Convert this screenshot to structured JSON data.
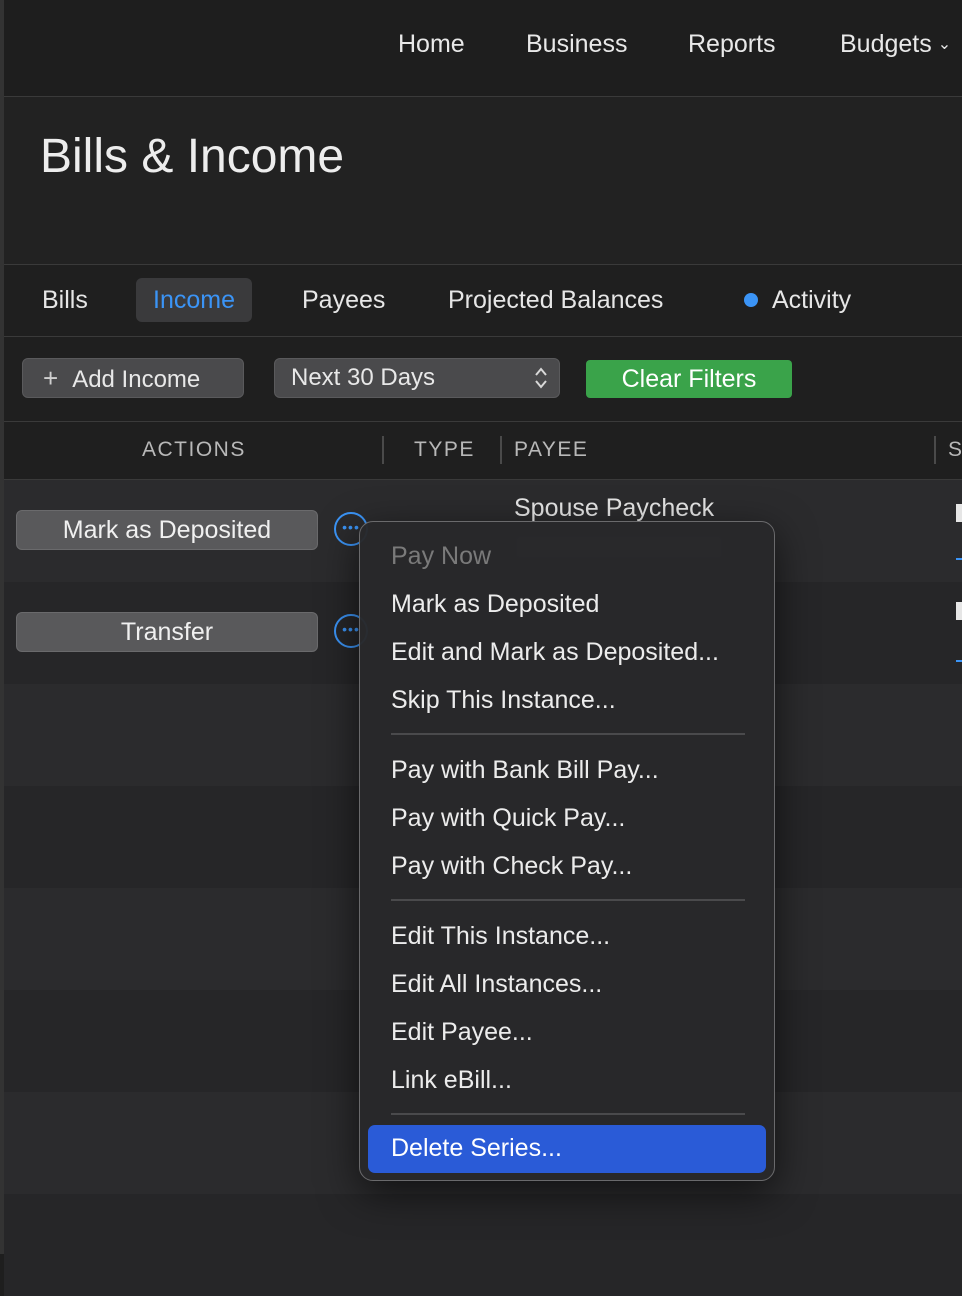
{
  "nav": {
    "items": [
      "Home",
      "Business",
      "Reports",
      "Budgets"
    ]
  },
  "header": {
    "title": "Bills & Income"
  },
  "tabs": [
    {
      "label": "Bills"
    },
    {
      "label": "Income",
      "active": true
    },
    {
      "label": "Payees"
    },
    {
      "label": "Projected Balances"
    },
    {
      "label": "Activity",
      "indicator": "blue-dot"
    }
  ],
  "toolbar": {
    "add_label": "Add Income",
    "range_value": "Next 30 Days",
    "clear_label": "Clear Filters"
  },
  "table": {
    "columns": [
      "ACTIONS",
      "TYPE",
      "PAYEE",
      "S"
    ],
    "rows": [
      {
        "action": "Mark as Deposited",
        "payee": "Spouse Paycheck"
      },
      {
        "action": "Transfer",
        "payee": ""
      }
    ]
  },
  "menu": {
    "items": [
      "Pay Now",
      "Mark as Deposited",
      "Edit and Mark as Deposited...",
      "Skip This Instance...",
      "Pay with Bank Bill Pay...",
      "Pay with Quick Pay...",
      "Pay with Check Pay...",
      "Edit This Instance...",
      "Edit All Instances...",
      "Edit Payee...",
      "Link eBill...",
      "Delete Series..."
    ],
    "disabled": [
      "Pay Now"
    ],
    "highlighted": "Delete Series..."
  },
  "colors": {
    "accent": "#3b94f6",
    "clear_button": "#3aa34a",
    "menu_highlight": "#2a5bd7"
  }
}
